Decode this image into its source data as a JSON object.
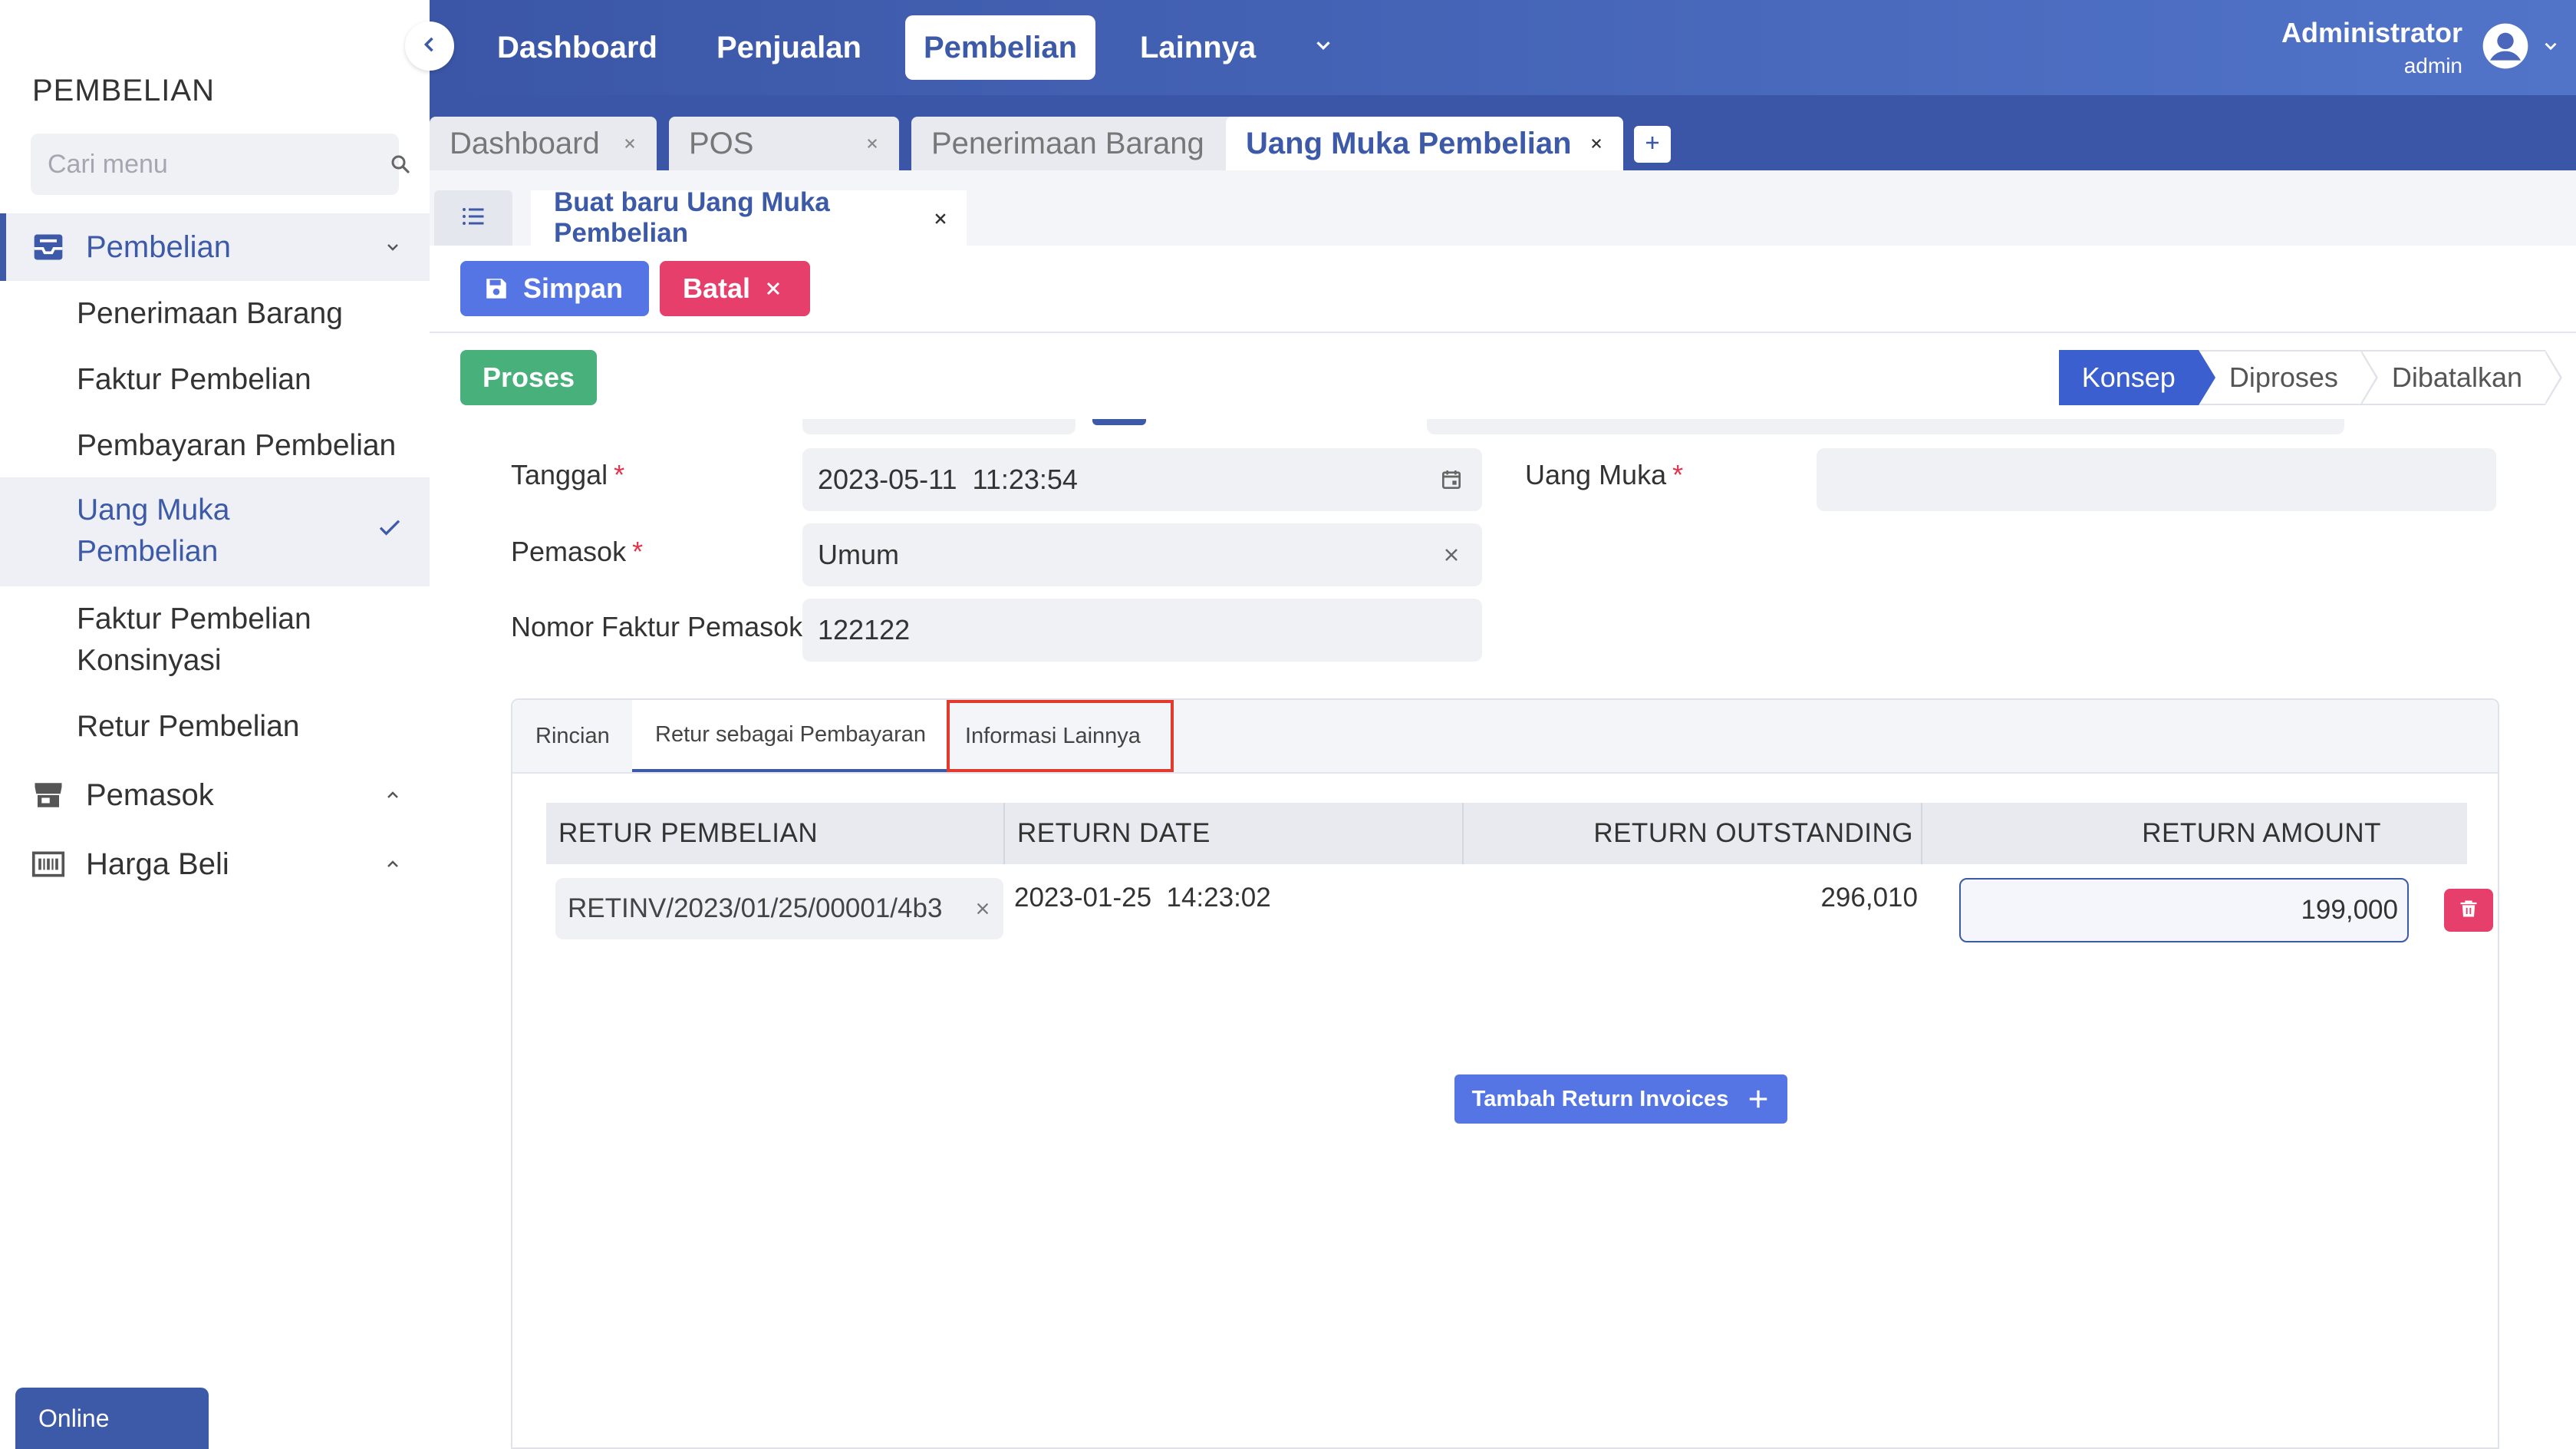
{
  "sidebar": {
    "title": "PEMBELIAN",
    "search_placeholder": "Cari menu",
    "groups": [
      {
        "label": "Pembelian",
        "icon": "inbox-tray-icon"
      },
      {
        "label": "Pemasok",
        "icon": "store-icon"
      },
      {
        "label": "Harga Beli",
        "icon": "barcode-icon"
      }
    ],
    "items": [
      {
        "label": "Penerimaan Barang"
      },
      {
        "label": "Faktur Pembelian"
      },
      {
        "label": "Pembayaran Pembelian"
      },
      {
        "label": "Uang Muka\nPembelian",
        "line1": "Uang Muka",
        "line2": "Pembelian",
        "selected": true
      },
      {
        "label": "Faktur Pembelian Konsinyasi",
        "line1": "Faktur Pembelian",
        "line2": "Konsinyasi"
      },
      {
        "label": "Retur Pembelian"
      }
    ],
    "online_label": "Online"
  },
  "topnav": {
    "items": [
      {
        "label": "Dashboard"
      },
      {
        "label": "Penjualan"
      },
      {
        "label": "Pembelian",
        "active": true
      },
      {
        "label": "Lainnya"
      }
    ],
    "user_name": "Administrator",
    "user_role": "admin"
  },
  "window_tabs": [
    {
      "label": "Dashboard"
    },
    {
      "label": "POS"
    },
    {
      "label": "Penerimaan Barang"
    },
    {
      "label": "Uang Muka Pembelian",
      "active": true
    }
  ],
  "subtab": {
    "label": "Buat baru Uang Muka Pembelian"
  },
  "actions": {
    "save_label": "Simpan",
    "cancel_label": "Batal",
    "process_label": "Proses"
  },
  "status_steps": [
    {
      "label": "Konsep",
      "active": true
    },
    {
      "label": "Diproses"
    },
    {
      "label": "Dibatalkan"
    }
  ],
  "form": {
    "tanggal_label": "Tanggal",
    "tanggal_value": "2023-05-11  11:23:54",
    "pemasok_label": "Pemasok",
    "pemasok_value": "Umum",
    "nomor_faktur_label": "Nomor Faktur Pemasok",
    "nomor_faktur_value": "122122",
    "uang_muka_label": "Uang Muka",
    "uang_muka_value": "",
    "required_mark": "*"
  },
  "panel": {
    "tabs": [
      {
        "label": "Rincian"
      },
      {
        "label": "Retur sebagai Pembayaran",
        "active": true
      },
      {
        "label": "Informasi Lainnya",
        "highlighted": true
      }
    ],
    "columns": [
      "RETUR PEMBELIAN",
      "RETURN DATE",
      "RETURN OUTSTANDING",
      "RETURN AMOUNT"
    ],
    "rows": [
      {
        "retur": "RETINV/2023/01/25/00001/4b3",
        "date": "2023-01-25  14:23:02",
        "outstanding": "296,010",
        "amount": "199,000"
      }
    ],
    "add_button_label": "Tambah Return Invoices"
  },
  "colors": {
    "primary": "#3c5aa8",
    "save": "#5575e5",
    "cancel": "#e73f6c",
    "process": "#48b07b",
    "highlight_border": "#e23b2e"
  }
}
